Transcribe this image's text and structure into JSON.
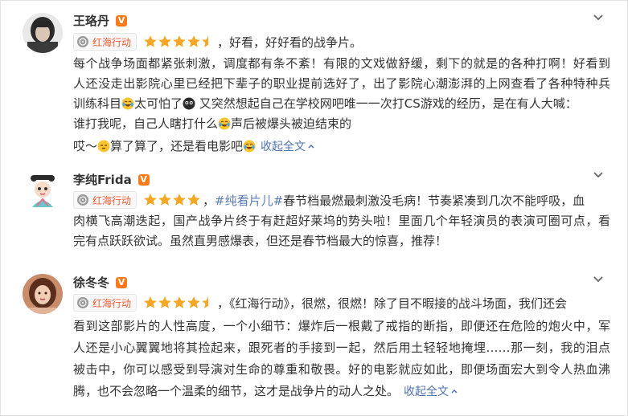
{
  "reviews": [
    {
      "user": "王珞丹",
      "badge": "V",
      "movie_tag": "红海行动",
      "rating": 4.5,
      "lead_text": "，好看，好好看的战争片。",
      "lines": [
        "每个战争场面都紧张刺激，调度都有条不紊！有限的文戏做舒缓，剩下的就是的各种打啊！好看到",
        "人还没走出影院心里已经把下辈子的职业提前选好了，出了影院心潮澎湃的上网查看了各种特种兵",
        "训练科目",
        "太可怕了",
        " 又突然想起自己在学校网吧唯一一次打CS游戏的经历，是在有人大喊：",
        "谁打我呢，自己人瞎打什么",
        "声后被爆头被迫结束的",
        "哎～",
        "算了算了，还是看电影吧"
      ],
      "collapse": "收起全文"
    },
    {
      "user": "李纯Frida",
      "badge": "V",
      "movie_tag": "红海行动",
      "rating": 4,
      "lead_text": "，",
      "hashtag": "#纯看片儿#",
      "lines": [
        "春节档最燃最刺激没毛病！节奏紧凑到几次不能呼吸，血",
        "肉横飞高潮迭起，国产战争片终于有赶超好莱坞的势头啦！里面几个年轻演员的表演可圈可点，看",
        "完有点跃跃欲试。虽然直男感爆表，但还是春节档最大的惊喜，推荐！"
      ]
    },
    {
      "user": "徐冬冬",
      "badge": "V",
      "movie_tag": "红海行动",
      "rating": 4.5,
      "lead_text": "，《红海行动》，很燃，很燃！除了目不暇接的战斗场面，我们还会",
      "lines": [
        "看到这部影片的人性高度，一个小细节：爆炸后一根戴了戒指的断指，即便还在危险的炮火中，军",
        "人还是小心翼翼地将其捡起来，跟死者的手接到一起，然后用土轻轻地掩埋……那一刻，我的泪点",
        "被击中，你可以感受到导演对生命的尊重和敬畏。好的电影就应如此，即便场面宏大到令人热血沸",
        "腾，也不会忽略一个温柔的细节，这才是战争片的动人之处。"
      ],
      "collapse": "收起全文"
    }
  ],
  "icons": {
    "verified": "verified-v-badge",
    "movie": "film-reel-icon",
    "star": "star-icon",
    "more": "chevron-down-icon",
    "collapse": "chevron-up-icon",
    "emoji_laugh_cry": "laugh-cry-emoji",
    "emoji_dark": "dark-face-emoji",
    "emoji_sigh": "sigh-emoji"
  },
  "colors": {
    "star": "#f5a623",
    "tag_text": "#ef5a31",
    "link": "#4f74b2",
    "badge": "#ff7a1a"
  }
}
